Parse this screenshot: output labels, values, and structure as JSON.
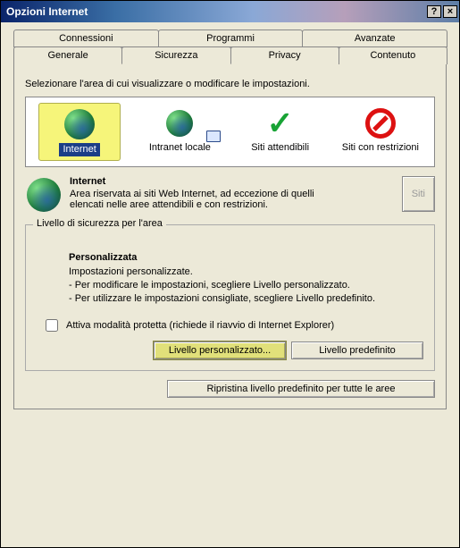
{
  "titlebar": {
    "title": "Opzioni Internet",
    "help_glyph": "?",
    "close_glyph": "×"
  },
  "tabs": {
    "row1": [
      {
        "label": "Connessioni"
      },
      {
        "label": "Programmi"
      },
      {
        "label": "Avanzate"
      }
    ],
    "row2": [
      {
        "label": "Generale"
      },
      {
        "label": "Sicurezza"
      },
      {
        "label": "Privacy"
      },
      {
        "label": "Contenuto"
      }
    ],
    "selected": "Sicurezza"
  },
  "instruction": "Selezionare l'area di cui visualizzare o modificare le impostazioni.",
  "zones": [
    {
      "label": "Internet",
      "icon": "globe",
      "selected": true
    },
    {
      "label": "Intranet locale",
      "icon": "intranet",
      "selected": false
    },
    {
      "label": "Siti attendibili",
      "icon": "check",
      "selected": false
    },
    {
      "label": "Siti con restrizioni",
      "icon": "restricted",
      "selected": false
    }
  ],
  "zone_desc": {
    "heading": "Internet",
    "text": "Area riservata ai siti Web Internet, ad eccezione di quelli elencati nelle aree attendibili e con restrizioni.",
    "sites_button": "Siti"
  },
  "security_level": {
    "legend": "Livello di sicurezza per l'area",
    "heading": "Personalizzata",
    "line1": "Impostazioni personalizzate.",
    "line2": "- Per modificare le impostazioni, scegliere Livello personalizzato.",
    "line3": "- Per utilizzare le impostazioni consigliate, scegliere Livello predefinito.",
    "protected_mode": "Attiva modalità protetta (richiede il riavvio di Internet Explorer)",
    "custom_button": "Livello personalizzato...",
    "default_button": "Livello predefinito"
  },
  "reset_button": "Ripristina livello predefinito per tutte le aree"
}
